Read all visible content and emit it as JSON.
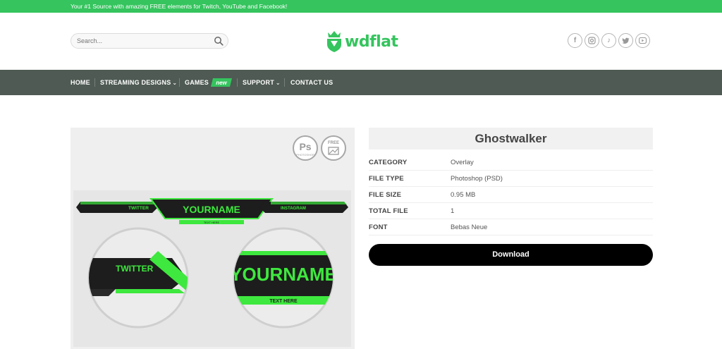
{
  "topbar": {
    "text": "Your #1 Source with amazing FREE elements for Twitch, YouTube and Facebook!"
  },
  "header": {
    "search_placeholder": "Search...",
    "logo_text": "wdflat",
    "social": [
      {
        "icon": "facebook-icon",
        "glyph": "f"
      },
      {
        "icon": "instagram-icon",
        "glyph": "◎"
      },
      {
        "icon": "tiktok-icon",
        "glyph": "♪"
      },
      {
        "icon": "twitter-icon",
        "glyph": "✈"
      },
      {
        "icon": "youtube-icon",
        "glyph": "▶"
      }
    ]
  },
  "nav": {
    "home": "HOME",
    "streaming": "STREAMING DESIGNS",
    "games": "GAMES",
    "new_badge": "new",
    "support": "SUPPORT",
    "contact": "CONTACT US"
  },
  "badges": {
    "ps": "Ps",
    "ps_sub": "PHOTOSHOP",
    "free": "FREE"
  },
  "preview": {
    "twitter": "TWITTER",
    "yourname": "YOURNAME",
    "instagram": "INSTAGRAM",
    "text_here": "TEXT HERE"
  },
  "product": {
    "title": "Ghostwalker",
    "details": [
      {
        "key": "CATEGORY",
        "value": "Overlay"
      },
      {
        "key": "FILE TYPE",
        "value": "Photoshop (PSD)"
      },
      {
        "key": "FILE SIZE",
        "value": "0.95 MB"
      },
      {
        "key": "TOTAL FILE",
        "value": "1"
      },
      {
        "key": "FONT",
        "value": "Bebas Neue"
      }
    ],
    "download_label": "Download"
  },
  "colors": {
    "brand_green": "#35c45e",
    "nav_bg": "#4e5a53",
    "neon": "#3ee83e"
  }
}
